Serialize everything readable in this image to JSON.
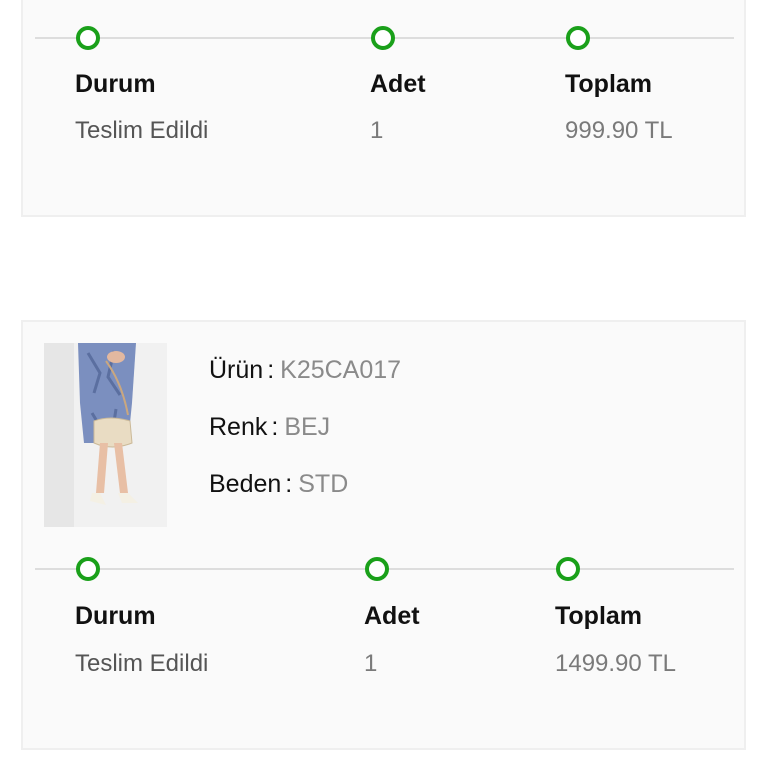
{
  "orders": [
    {
      "durum_label": "Durum",
      "durum_value": "Teslim Edildi",
      "adet_label": "Adet",
      "adet_value": "1",
      "toplam_label": "Toplam",
      "toplam_value": "999.90 TL"
    },
    {
      "product": {
        "urun_label": "Ürün",
        "urun_value": "K25CA017",
        "renk_label": "Renk",
        "renk_value": "BEJ",
        "beden_label": "Beden",
        "beden_value": "STD"
      },
      "durum_label": "Durum",
      "durum_value": "Teslim Edildi",
      "adet_label": "Adet",
      "adet_value": "1",
      "toplam_label": "Toplam",
      "toplam_value": "1499.90 TL"
    }
  ],
  "colors": {
    "status_green": "#1aa01a",
    "card_background": "#fafafa",
    "border": "#efefef"
  }
}
